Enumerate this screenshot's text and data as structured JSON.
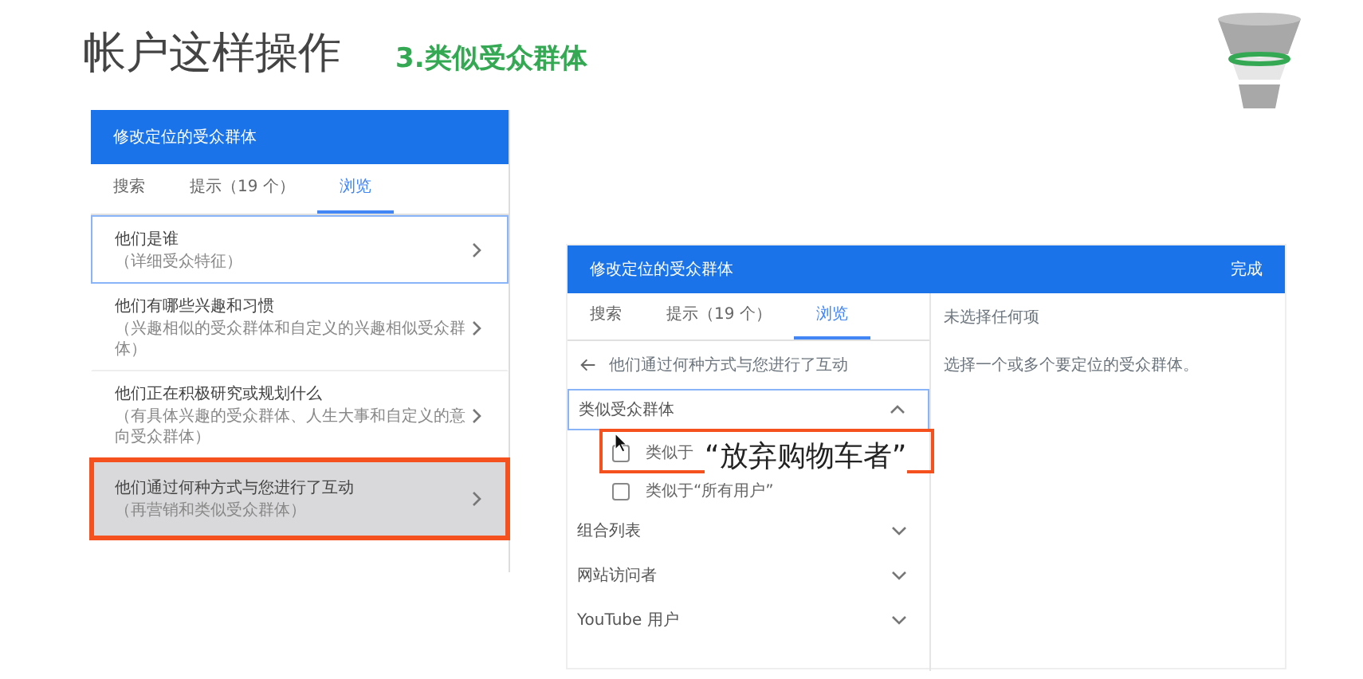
{
  "title": "帐户这样操作",
  "subtitle": "3.类似受众群体",
  "left_panel": {
    "header": "修改定位的受众群体",
    "tabs": [
      {
        "label": "搜索",
        "selected": false
      },
      {
        "label": "提示（19 个）",
        "selected": false
      },
      {
        "label": "浏览",
        "selected": true
      }
    ],
    "items": [
      {
        "title": "他们是谁",
        "subtitle": "（详细受众特征）",
        "focused": true,
        "selected": false
      },
      {
        "title": "他们有哪些兴趣和习惯",
        "subtitle": "（兴趣相似的受众群体和自定义的兴趣相似受众群体）",
        "focused": false,
        "selected": false
      },
      {
        "title": "他们正在积极研究或规划什么",
        "subtitle": "（有具体兴趣的受众群体、人生大事和自定义的意向受众群体）",
        "focused": false,
        "selected": false
      },
      {
        "title": "他们通过何种方式与您进行了互动",
        "subtitle": "（再营销和类似受众群体）",
        "focused": false,
        "selected": true
      }
    ]
  },
  "right_panel": {
    "header": "修改定位的受众群体",
    "done": "完成",
    "tabs": [
      {
        "label": "搜索",
        "selected": false
      },
      {
        "label": "提示（19 个）",
        "selected": false
      },
      {
        "label": "浏览",
        "selected": true
      }
    ],
    "back_label": "他们通过何种方式与您进行了互动",
    "sections": [
      {
        "label": "类似受众群体",
        "expanded": true,
        "options": [
          {
            "label": "类似于",
            "checked": false,
            "highlighted": true
          },
          {
            "label": "类似于“所有用户”",
            "checked": false,
            "highlighted": false
          }
        ]
      },
      {
        "label": "组合列表",
        "expanded": false
      },
      {
        "label": "网站访问者",
        "expanded": false
      },
      {
        "label": "YouTube 用户",
        "expanded": false
      }
    ],
    "status": "未选择任何项",
    "hint": "选择一个或多个要定位的受众群体。"
  },
  "callout": "“放弃购物车者”"
}
